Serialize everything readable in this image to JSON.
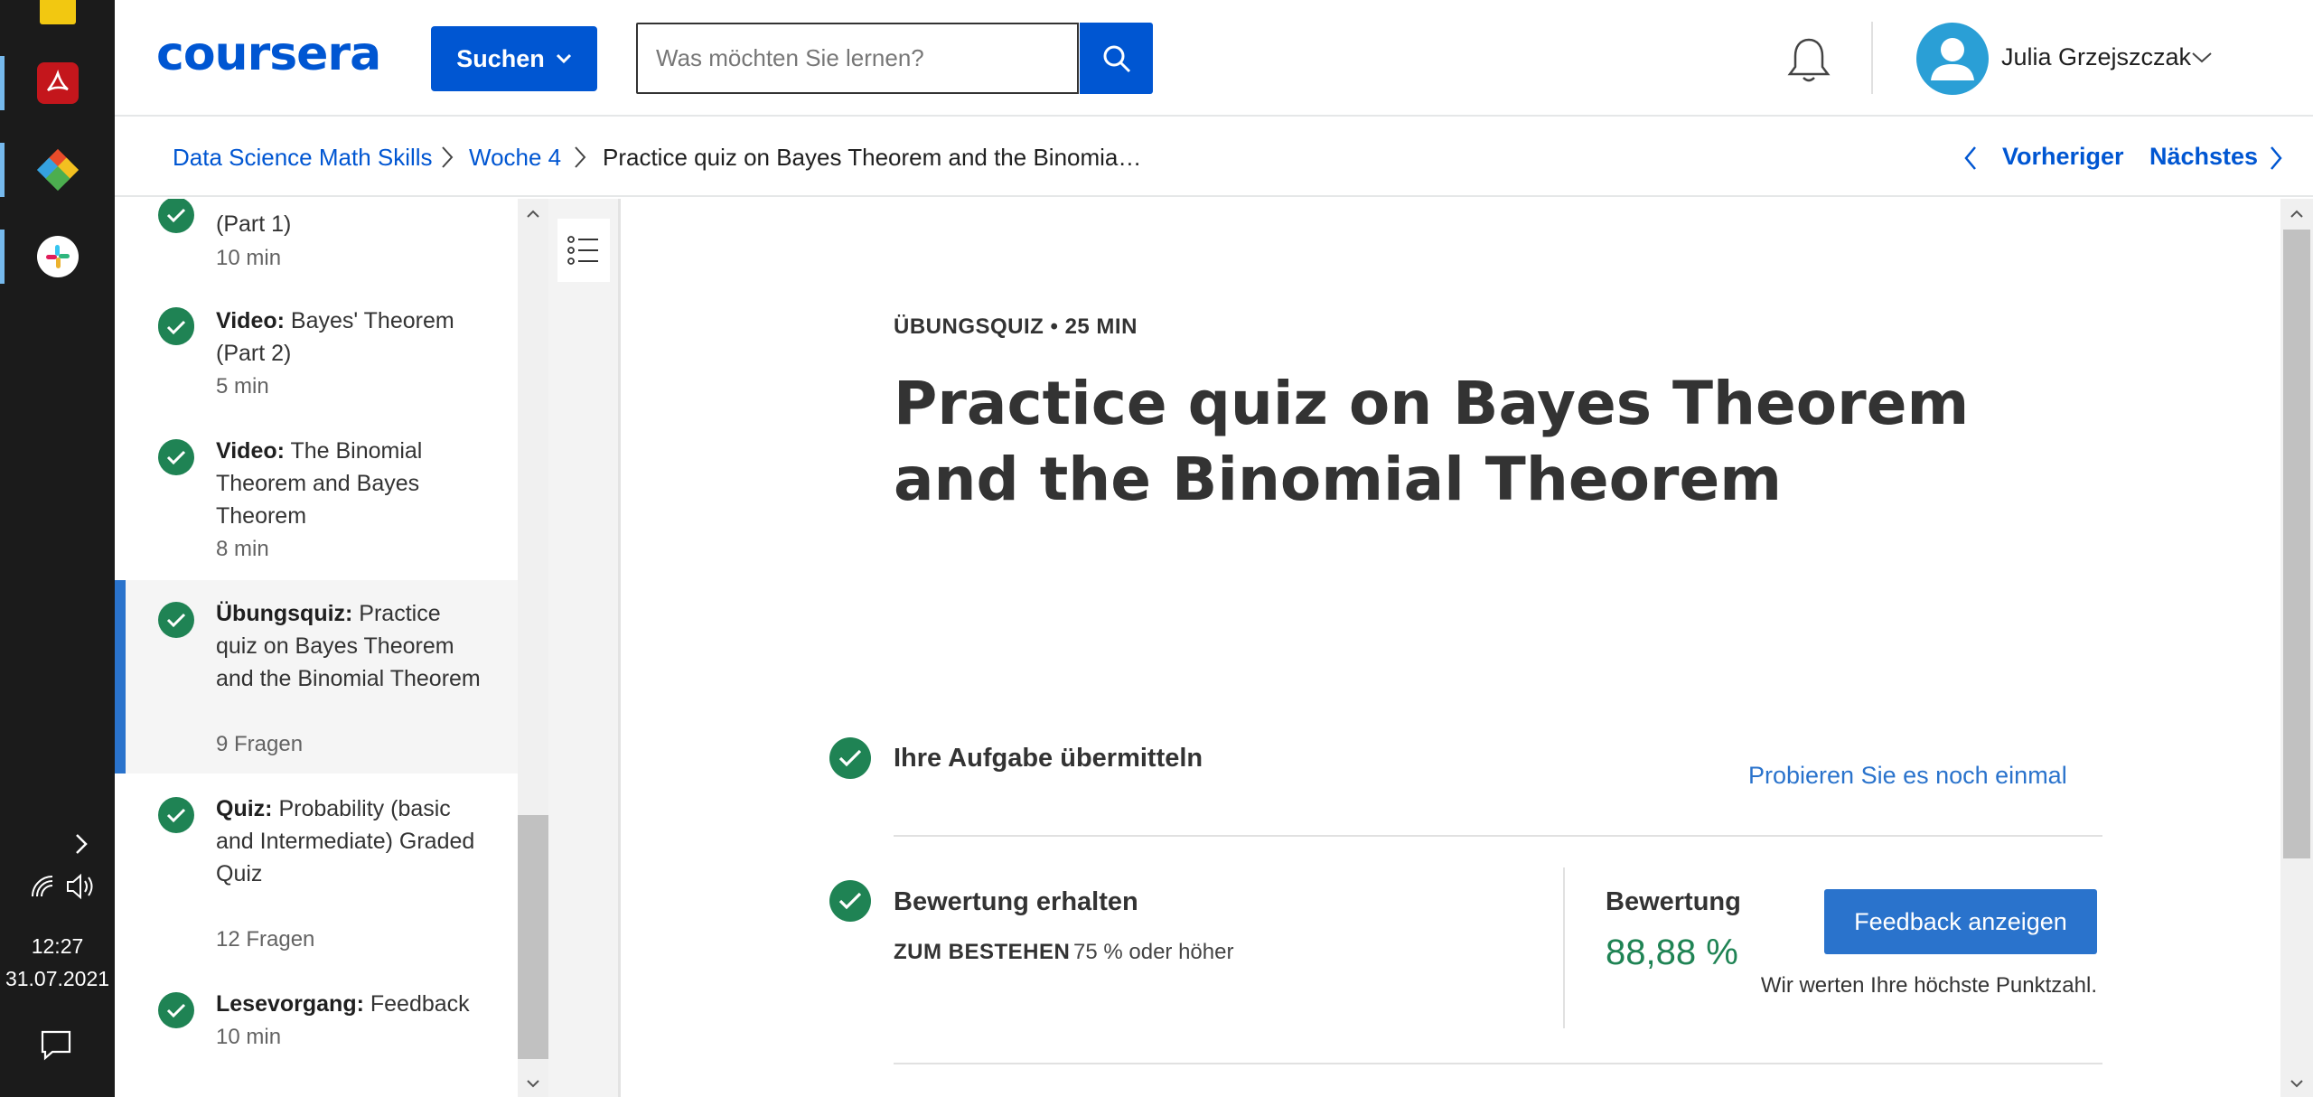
{
  "taskbar": {
    "apps": [
      {
        "name": "file-explorer-icon",
        "color": "#f2c811"
      },
      {
        "name": "acrobat-icon",
        "color": "#c4161c"
      },
      {
        "name": "paint-app-icon",
        "color": "#e0a526"
      },
      {
        "name": "slack-icon",
        "color": "#ffffff"
      }
    ],
    "time": "12:27",
    "date": "31.07.2021"
  },
  "header": {
    "logo": "coursera",
    "search_menu_label": "Suchen",
    "search_placeholder": "Was möchten Sie lernen?",
    "user_name": "Julia Grzejszczak",
    "accent": "#0056d2"
  },
  "breadcrumb": {
    "course": "Data Science Math Skills",
    "week": "Woche 4",
    "current": "Practice quiz on Bayes Theorem and the Binomia…",
    "prev_label": "Vorheriger",
    "next_label": "Nächstes"
  },
  "sidebar": {
    "items": [
      {
        "type": "",
        "title": "(Part 1)",
        "meta": "10 min"
      },
      {
        "type": "Video:",
        "title": " Bayes' Theorem (Part 2)",
        "meta": "5 min"
      },
      {
        "type": "Video:",
        "title": " The Binomial Theorem and Bayes Theorem",
        "meta": "8 min"
      },
      {
        "type": "Übungsquiz:",
        "title": " Practice quiz on Bayes Theorem and the Binomial Theorem",
        "meta": "9 Fragen"
      },
      {
        "type": "Quiz:",
        "title": " Probability (basic and Intermediate) Graded Quiz",
        "meta": "12 Fragen"
      },
      {
        "type": "Lesevorgang:",
        "title": " Feedback",
        "meta": "10 min"
      }
    ]
  },
  "main": {
    "kicker": "ÜBUNGSQUIZ • 25 MIN",
    "title": "Practice quiz on Bayes Theorem and the Binomial Theorem",
    "step1_title": "Ihre Aufgabe übermitteln",
    "retry_label": "Probieren Sie es noch einmal",
    "step2_title": "Bewertung erhalten",
    "pass_label": "ZUM BESTEHEN",
    "pass_value": "75 % oder höher",
    "grade_label": "Bewertung",
    "grade_value": "88,88 %",
    "feedback_button": "Feedback anzeigen",
    "highest_note": "Wir werten Ihre höchste Punktzahl."
  }
}
